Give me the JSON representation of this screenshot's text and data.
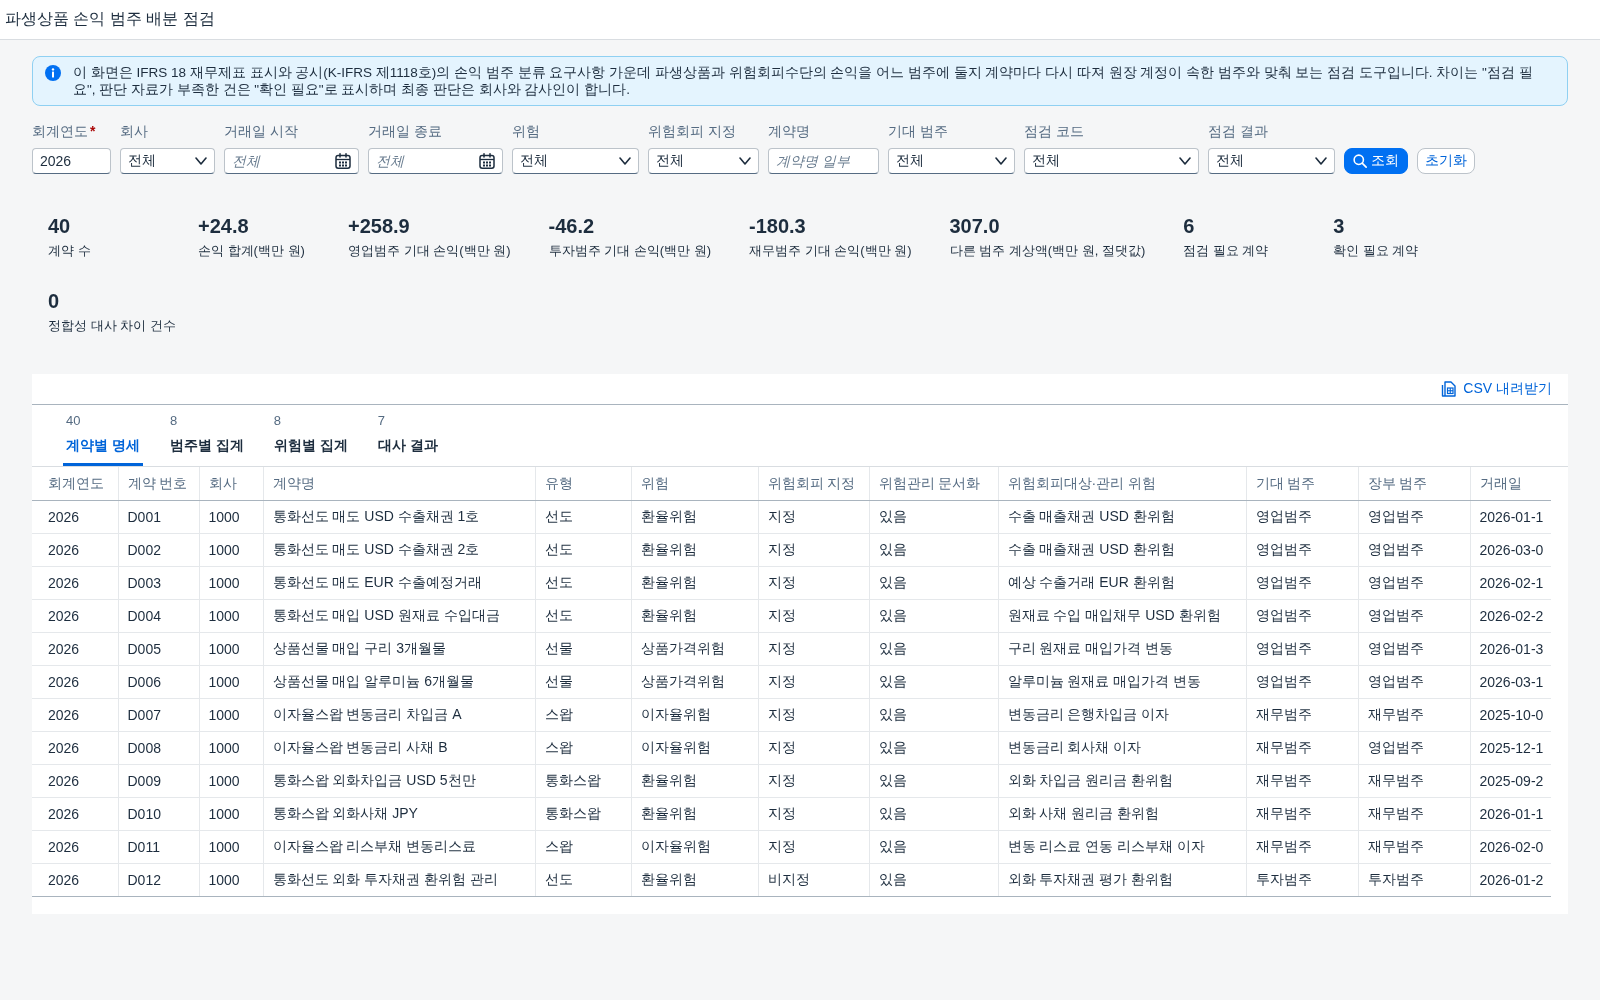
{
  "page": {
    "title": "파생상품 손익 범주 배분 점검"
  },
  "notice": {
    "text": "이 화면은 IFRS 18 재무제표 표시와 공시(K-IFRS 제1118호)의 손익 범주 분류 요구사항 가운데 파생상품과 위험회피수단의 손익을 어느 범주에 둘지 계약마다 다시 따져 원장 계정이 속한 범주와 맞춰 보는 점검 도구입니다. 차이는 \"점검 필요\", 판단 자료가 부족한 건은 \"확인 필요\"로 표시하며 최종 판단은 회사와 감사인이 합니다."
  },
  "filters": [
    {
      "kind": "text",
      "label": "회계연도",
      "required_mark": "*",
      "value": "2026"
    },
    {
      "kind": "select",
      "label": "회사",
      "value": "전체"
    },
    {
      "kind": "date",
      "label": "거래일 시작",
      "placeholder": "전체"
    },
    {
      "kind": "date",
      "label": "거래일 종료",
      "placeholder": "전체"
    },
    {
      "kind": "select",
      "label": "위험",
      "value": "전체"
    },
    {
      "kind": "select",
      "label": "위험회피 지정",
      "value": "전체"
    },
    {
      "kind": "text",
      "label": "계약명",
      "placeholder": "계약명 일부"
    },
    {
      "kind": "select",
      "label": "기대 범주",
      "value": "전체"
    },
    {
      "kind": "select",
      "label": "점검 코드",
      "value": "전체"
    },
    {
      "kind": "select",
      "label": "점검 결과",
      "value": "전체"
    }
  ],
  "buttons": [
    {
      "kind": "primary",
      "label": "조회"
    },
    {
      "kind": "secondary",
      "label": "초기화"
    }
  ],
  "kpis": [
    {
      "value": "40",
      "label": "계약 수"
    },
    {
      "value": "+24.8",
      "label": "손익 합계(백만 원)"
    },
    {
      "value": "+258.9",
      "label": "영업범주 기대 손익(백만 원)"
    },
    {
      "value": "-46.2",
      "label": "투자범주 기대 손익(백만 원)"
    },
    {
      "value": "-180.3",
      "label": "재무범주 기대 손익(백만 원)"
    },
    {
      "value": "307.0",
      "label": "다른 범주 계상액(백만 원, 절댓값)"
    },
    {
      "value": "6",
      "label": "점검 필요 계약"
    },
    {
      "value": "3",
      "label": "확인 필요 계약"
    },
    {
      "value": "0",
      "label": "정합성 대사 차이 건수"
    }
  ],
  "table_panel": {
    "export_button": "CSV 내려받기",
    "tabs": [
      {
        "count": "40",
        "label": "계약별 명세",
        "selected": true
      },
      {
        "count": "8",
        "label": "범주별 집계",
        "selected": false
      },
      {
        "count": "8",
        "label": "위험별 집계",
        "selected": false
      },
      {
        "count": "7",
        "label": "대사 결과",
        "selected": false
      }
    ],
    "table": {
      "columns": [
        "회계연도",
        "계약 번호",
        "회사",
        "계약명",
        "유형",
        "위험",
        "위험회피 지정",
        "위험관리 문서화",
        "위험회피대상·관리 위험",
        "기대 범주",
        "장부 범주",
        "거래일"
      ],
      "rows": [
        [
          "2026",
          "D001",
          "1000",
          "통화선도 매도 USD 수출채권 1호",
          "선도",
          "환율위험",
          "지정",
          "있음",
          "수출 매출채권 USD 환위험",
          "영업범주",
          "영업범주",
          "2026-01-1"
        ],
        [
          "2026",
          "D002",
          "1000",
          "통화선도 매도 USD 수출채권 2호",
          "선도",
          "환율위험",
          "지정",
          "있음",
          "수출 매출채권 USD 환위험",
          "영업범주",
          "영업범주",
          "2026-03-0"
        ],
        [
          "2026",
          "D003",
          "1000",
          "통화선도 매도 EUR 수출예정거래",
          "선도",
          "환율위험",
          "지정",
          "있음",
          "예상 수출거래 EUR 환위험",
          "영업범주",
          "영업범주",
          "2026-02-1"
        ],
        [
          "2026",
          "D004",
          "1000",
          "통화선도 매입 USD 원재료 수입대금",
          "선도",
          "환율위험",
          "지정",
          "있음",
          "원재료 수입 매입채무 USD 환위험",
          "영업범주",
          "영업범주",
          "2026-02-2"
        ],
        [
          "2026",
          "D005",
          "1000",
          "상품선물 매입 구리 3개월물",
          "선물",
          "상품가격위험",
          "지정",
          "있음",
          "구리 원재료 매입가격 변동",
          "영업범주",
          "영업범주",
          "2026-01-3"
        ],
        [
          "2026",
          "D006",
          "1000",
          "상품선물 매입 알루미늄 6개월물",
          "선물",
          "상품가격위험",
          "지정",
          "있음",
          "알루미늄 원재료 매입가격 변동",
          "영업범주",
          "영업범주",
          "2026-03-1"
        ],
        [
          "2026",
          "D007",
          "1000",
          "이자율스왑 변동금리 차입금 A",
          "스왑",
          "이자율위험",
          "지정",
          "있음",
          "변동금리 은행차입금 이자",
          "재무범주",
          "재무범주",
          "2025-10-0"
        ],
        [
          "2026",
          "D008",
          "1000",
          "이자율스왑 변동금리 사채 B",
          "스왑",
          "이자율위험",
          "지정",
          "있음",
          "변동금리 회사채 이자",
          "재무범주",
          "영업범주",
          "2025-12-1"
        ],
        [
          "2026",
          "D009",
          "1000",
          "통화스왑 외화차입금 USD 5천만",
          "통화스왑",
          "환율위험",
          "지정",
          "있음",
          "외화 차입금 원리금 환위험",
          "재무범주",
          "재무범주",
          "2025-09-2"
        ],
        [
          "2026",
          "D010",
          "1000",
          "통화스왑 외화사채 JPY",
          "통화스왑",
          "환율위험",
          "지정",
          "있음",
          "외화 사채 원리금 환위험",
          "재무범주",
          "재무범주",
          "2026-01-1"
        ],
        [
          "2026",
          "D011",
          "1000",
          "이자율스왑 리스부채 변동리스료",
          "스왑",
          "이자율위험",
          "지정",
          "있음",
          "변동 리스료 연동 리스부채 이자",
          "재무범주",
          "재무범주",
          "2026-02-0"
        ],
        [
          "2026",
          "D012",
          "1000",
          "통화선도 외화 투자채권 환위험 관리",
          "선도",
          "환율위험",
          "비지정",
          "있음",
          "외화 투자채권 평가 환위험",
          "투자범주",
          "투자범주",
          "2026-01-2"
        ]
      ]
    }
  }
}
